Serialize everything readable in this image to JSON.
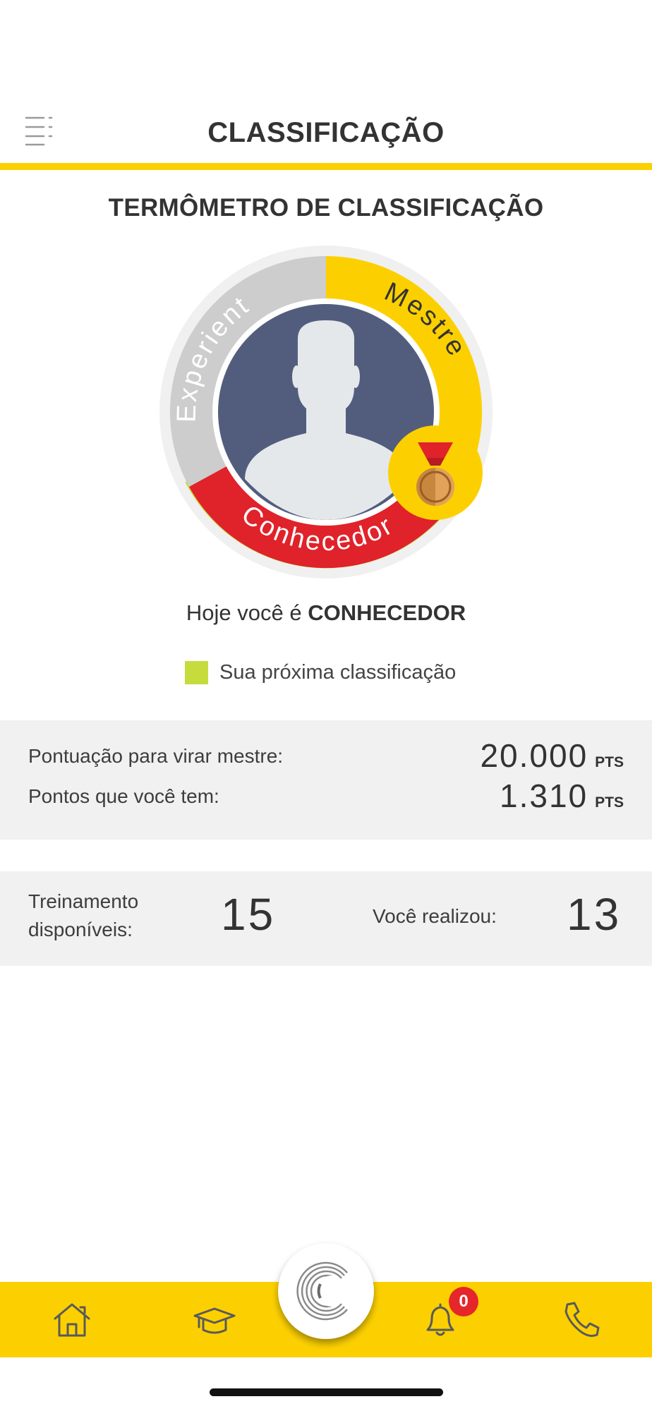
{
  "header": {
    "title": "CLASSIFICAÇÃO",
    "menu_icon": "menu-lines-icon"
  },
  "thermometer": {
    "title": "TERMÔMETRO DE CLASSIFICAÇÃO",
    "segments": [
      "Experiente",
      "Mestre",
      "Conhecedor"
    ],
    "colors": {
      "experiente": "#cdcdcd",
      "mestre": "#fcd000",
      "conhecedor": "#e0222a",
      "next": "#c6dc3c",
      "avatar_bg": "#525d7e"
    },
    "avatar_icon": "user-silhouette-icon",
    "medal_icon": "medal-icon"
  },
  "today": {
    "prefix": "Hoje você é",
    "level": "CONHECEDOR"
  },
  "legend": {
    "label": "Sua próxima classificação",
    "color": "#c6dc3c"
  },
  "points": {
    "target_label": "Pontuação para virar mestre:",
    "target_value": "20.000",
    "current_label": "Pontos que você tem:",
    "current_value": "1.310",
    "unit": "PTS"
  },
  "training": {
    "available_label_line1": "Treinamento",
    "available_label_line2": "disponíveis:",
    "available_count": "15",
    "done_label": "Você realizou:",
    "done_count": "13"
  },
  "tabbar": {
    "items": [
      "home-icon",
      "graduation-cap-icon",
      "app-logo-icon",
      "bell-icon",
      "phone-icon"
    ],
    "notifications": "0",
    "accent": "#fcd000"
  }
}
